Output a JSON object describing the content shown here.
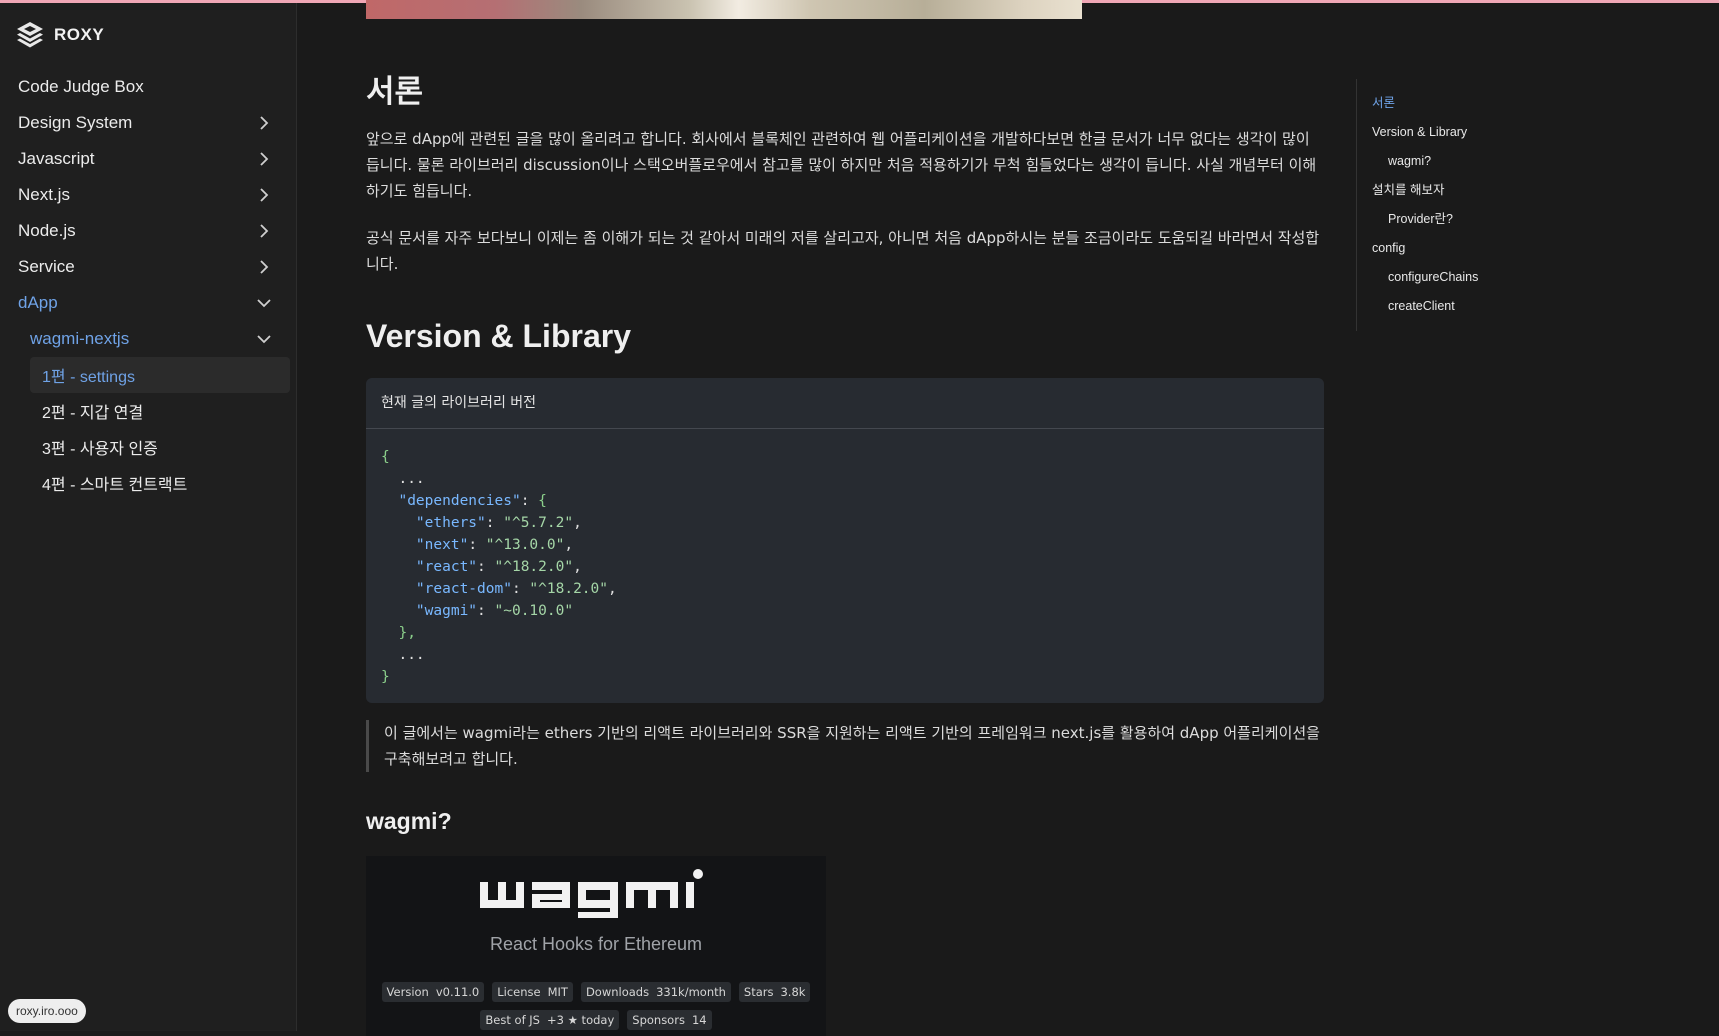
{
  "brand": {
    "name": "ROXY"
  },
  "sidebar": {
    "items": [
      {
        "label": "Code Judge Box",
        "chevron": "none"
      },
      {
        "label": "Design System",
        "chevron": "right"
      },
      {
        "label": "Javascript",
        "chevron": "right"
      },
      {
        "label": "Next.js",
        "chevron": "right"
      },
      {
        "label": "Node.js",
        "chevron": "right"
      },
      {
        "label": "Service",
        "chevron": "right"
      },
      {
        "label": "dApp",
        "chevron": "down"
      }
    ],
    "sub": {
      "label": "wagmi-nextjs",
      "chevron": "down"
    },
    "posts": [
      {
        "label": "1편 - settings"
      },
      {
        "label": "2편 - 지갑 연결"
      },
      {
        "label": "3편 - 사용자 인증"
      },
      {
        "label": "4편 - 스마트 컨트랙트"
      }
    ],
    "footer": "roxy.iro.ooo"
  },
  "article": {
    "h_intro": "서론",
    "p1": "앞으로 dApp에 관련된 글을 많이 올리려고 합니다. 회사에서 블록체인 관련하여 웹 어플리케이션을 개발하다보면 한글 문서가 너무 없다는 생각이 많이 듭니다. 물론 라이브러리 discussion이나 스택오버플로우에서 참고를 많이 하지만 처음 적용하기가 무척 힘들었다는 생각이 듭니다. 사실 개념부터 이해하기도 힘듭니다.",
    "p2": "공식 문서를 자주 보다보니 이제는 좀 이해가 되는 것 같아서 미래의 저를 살리고자, 아니면 처음 dApp하시는 분들 조금이라도 도움되길 바라면서 작성합니다.",
    "h_version": "Version & Library",
    "code_title": "현재 글의 라이브러리 버전",
    "code": {
      "open": "{",
      "ellipsis": "...",
      "deps_key": "\"dependencies\"",
      "deps_open": "{",
      "deps": [
        {
          "k": "\"ethers\"",
          "v": "\"^5.7.2\"",
          "comma": ","
        },
        {
          "k": "\"next\"",
          "v": "\"^13.0.0\"",
          "comma": ","
        },
        {
          "k": "\"react\"",
          "v": "\"^18.2.0\"",
          "comma": ","
        },
        {
          "k": "\"react-dom\"",
          "v": "\"^18.2.0\"",
          "comma": ","
        },
        {
          "k": "\"wagmi\"",
          "v": "\"~0.10.0\"",
          "comma": ""
        }
      ],
      "deps_close": "},",
      "close": "}"
    },
    "quote": "이 글에서는 wagmi라는 ethers 기반의 리액트 라이브러리와 SSR을 지원하는 리액트 기반의 프레임워크 next.js를 활용하여 dApp 어플리케이션을 구축해보려고 합니다.",
    "h_wagmi": "wagmi?",
    "wagmi_card": {
      "logo_text": "wagmi",
      "tagline": "React Hooks for Ethereum",
      "badges_row1": [
        {
          "l": "Version",
          "r": "v0.11.0"
        },
        {
          "l": "License",
          "r": "MIT"
        },
        {
          "l": "Downloads",
          "r": "331k/month"
        },
        {
          "l": "Stars",
          "r": "3.8k"
        }
      ],
      "badges_row2": [
        {
          "l": "Best of JS",
          "r": "+3 ★ today"
        },
        {
          "l": "Sponsors",
          "r": "14"
        }
      ]
    }
  },
  "toc": {
    "items": [
      {
        "label": "서론",
        "level": 1,
        "active": true
      },
      {
        "label": "Version & Library",
        "level": 1
      },
      {
        "label": "wagmi?",
        "level": 2
      },
      {
        "label": "설치를 해보자",
        "level": 1
      },
      {
        "label": "Provider란?",
        "level": 2
      },
      {
        "label": "config",
        "level": 1
      },
      {
        "label": "configureChains",
        "level": 2
      },
      {
        "label": "createClient",
        "level": 2
      }
    ]
  },
  "colors": {
    "accent": "#6fa2e6",
    "background": "#1a1a1a",
    "code_bg": "#272b31",
    "top_border": "#f0a7b6"
  }
}
